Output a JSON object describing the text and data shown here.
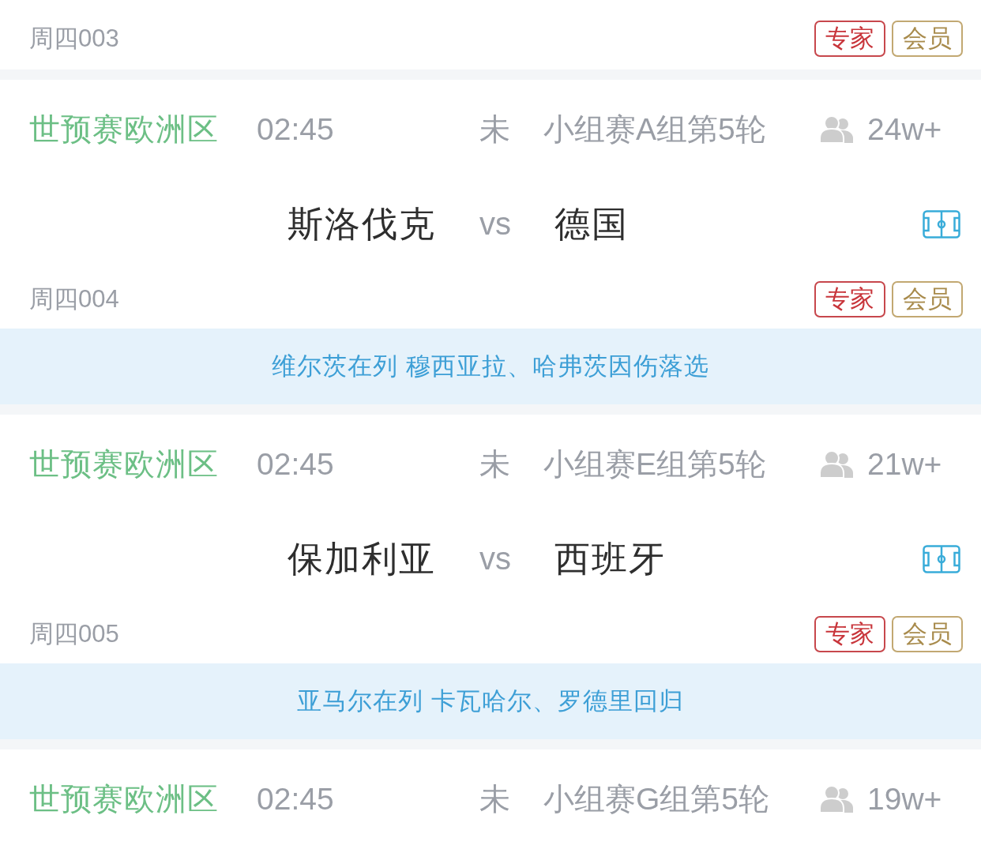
{
  "matches": [
    {
      "footer": {
        "code": "周四003",
        "tags": [
          {
            "label": "专家",
            "kind": "expert"
          },
          {
            "label": "会员",
            "kind": "member"
          }
        ]
      }
    },
    {
      "competition": "世预赛欧洲区",
      "time": "02:45",
      "status": "未",
      "round": "小组赛A组第5轮",
      "viewers": "24w+",
      "home": "斯洛伐克",
      "vs": "vs",
      "away": "德国",
      "footer": {
        "code": "周四004",
        "tags": [
          {
            "label": "专家",
            "kind": "expert"
          },
          {
            "label": "会员",
            "kind": "member"
          }
        ]
      },
      "news": "维尔茨在列 穆西亚拉、哈弗茨因伤落选"
    },
    {
      "competition": "世预赛欧洲区",
      "time": "02:45",
      "status": "未",
      "round": "小组赛E组第5轮",
      "viewers": "21w+",
      "home": "保加利亚",
      "vs": "vs",
      "away": "西班牙",
      "footer": {
        "code": "周四005",
        "tags": [
          {
            "label": "专家",
            "kind": "expert"
          },
          {
            "label": "会员",
            "kind": "member"
          }
        ]
      },
      "news": "亚马尔在列 卡瓦哈尔、罗德里回归"
    },
    {
      "competition": "世预赛欧洲区",
      "time": "02:45",
      "status": "未",
      "round": "小组赛G组第5轮",
      "viewers": "19w+"
    }
  ]
}
